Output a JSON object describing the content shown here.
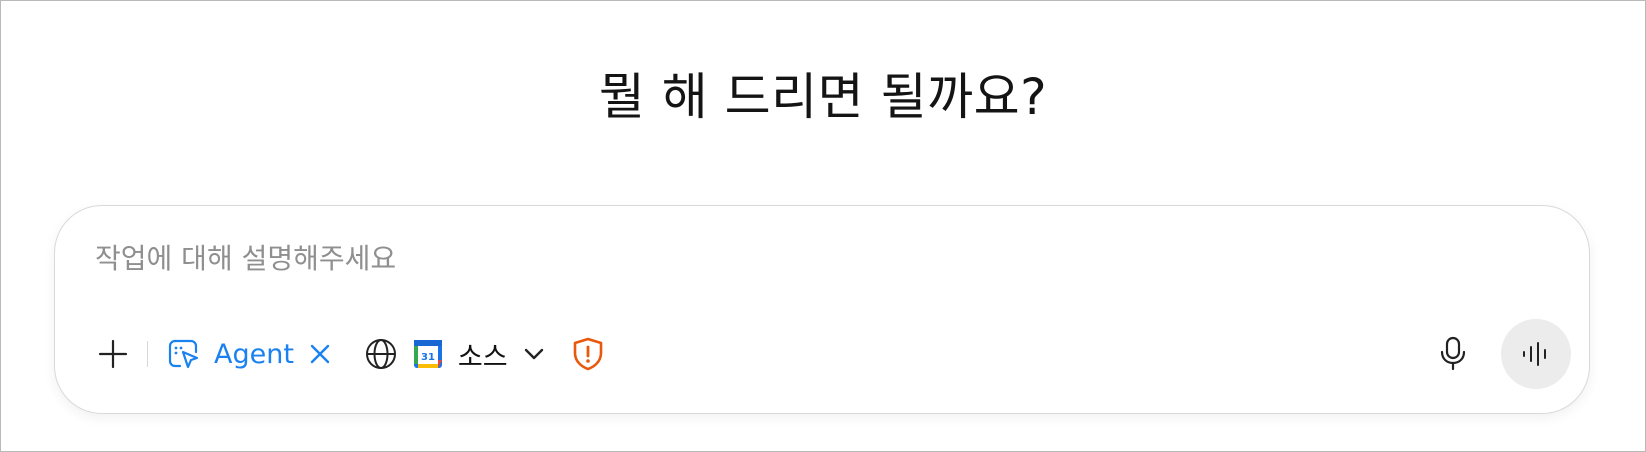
{
  "heading": "뭘 해 드리면 될까요?",
  "composer": {
    "placeholder": "작업에 대해 설명해주세요",
    "value": ""
  },
  "toolbar": {
    "add_icon": "plus-icon",
    "agent": {
      "label": "Agent",
      "icon": "agent-cursor-icon",
      "remove_icon": "close-icon",
      "color": "#1a82f0"
    },
    "sources": {
      "label": "소스",
      "icons": [
        "globe-icon",
        "google-calendar-icon",
        "chevron-down-icon"
      ],
      "calendar_day": "31"
    },
    "shield_icon": "shield-alert-icon",
    "shield_color": "#e8590c",
    "mic_icon": "microphone-icon",
    "voice_icon": "voice-waveform-icon"
  }
}
